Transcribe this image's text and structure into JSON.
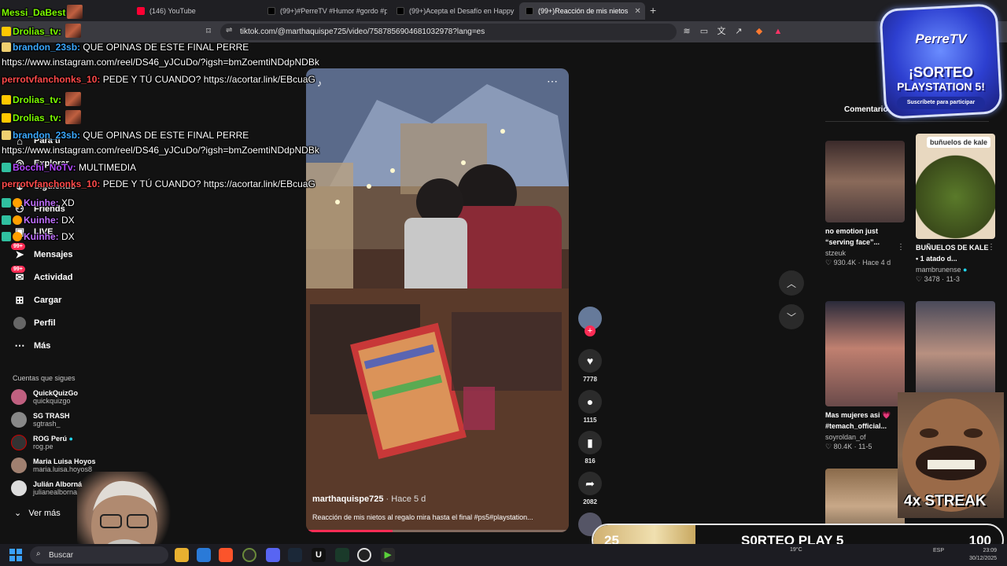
{
  "browser": {
    "tabs": [
      {
        "title": "(146) YouTube",
        "color": "#ff0033"
      },
      {
        "title": "(99+)#PerreTV #Humor #gordo #pe",
        "color": "#111111"
      },
      {
        "title": "(99+)Acepta el Desafío en Happy & G",
        "color": "#111111"
      },
      {
        "title": "(99+)Reacción de mis nietos",
        "color": "#111111"
      }
    ],
    "url": "tiktok.com/@marthaquispe725/video/7587856904681032978?lang=es"
  },
  "sidebar": {
    "nav": [
      {
        "label": "Para ti"
      },
      {
        "label": "Explorar"
      },
      {
        "label": "Siguiendo"
      },
      {
        "label": "Friends"
      },
      {
        "label": "LIVE"
      },
      {
        "label": "Mensajes",
        "badge": "99+"
      },
      {
        "label": "Actividad",
        "badge": "99+"
      },
      {
        "label": "Cargar"
      },
      {
        "label": "Perfil"
      },
      {
        "label": "Más"
      }
    ],
    "following_title": "Cuentas que sigues",
    "accounts": [
      {
        "name": "QuickQuizGo",
        "handle": "quickquizgo"
      },
      {
        "name": "SG TRASH",
        "handle": "sgtrash_"
      },
      {
        "name": "ROG Perú",
        "handle": "rog.pe"
      },
      {
        "name": "Maria Luisa Hoyos",
        "handle": "maria.luisa.hoyos8"
      },
      {
        "name": "Julián Alborná",
        "handle": "julianealborna"
      }
    ],
    "see_more": "Ver más"
  },
  "video": {
    "author": "marthaquispe725",
    "time": "· Hace 5 d",
    "caption": "Reacción de mis nietos al regalo mira hasta el final #ps5#playstation...",
    "progress": 0.33
  },
  "actions": {
    "likes": "7778",
    "comments": "1115",
    "saves": "816",
    "shares": "2082"
  },
  "right_panel": {
    "tab": "Comentarios",
    "cards": [
      {
        "title": "no emotion just “serving face”...",
        "user": "stzeuk",
        "meta": "♡ 930.4K · Hace 4 d",
        "thumb": "#6a4a3a"
      },
      {
        "title": "BUÑUELOS DE KALE • 1 atado d...",
        "user": "mambrunense",
        "meta": "♡ 3478 · 11-3",
        "thumb": "#4a5a2a",
        "overlay": "buñuelos de kale"
      },
      {
        "title": "Mas mujeres asi 💗 #temach_official...",
        "user": "soyroldan_of",
        "meta": "♡ 80.4K · 11-5",
        "thumb": "#7a5a6a"
      },
      {
        "title": "",
        "user": "",
        "meta": "",
        "thumb": "#5a5a6a"
      }
    ]
  },
  "chat": [
    {
      "user": "Messi_DaBest",
      "color": "#7cfc00",
      "text": ""
    },
    {
      "user": "Drolias_tv:",
      "color": "#7cfc00",
      "text": ""
    },
    {
      "user": "brandon_23sb:",
      "color": "#3aa8ff",
      "text": "QUE OPINAS DE ESTE FINAL PERRE"
    },
    {
      "user": "",
      "color": "#ffffff",
      "text": "https://www.instagram.com/reel/DS46_yJCuDo/?igsh=bmZoemtiNDdpNDBk"
    },
    {
      "user": "perrotvfanchonks_10:",
      "color": "#ff4a4a",
      "text": "PEDE Y TÚ CUANDO?  https://acortar.link/EBcuaG"
    },
    {
      "user": "Drolias_tv:",
      "color": "#7cfc00",
      "text": ""
    },
    {
      "user": "Drolias_tv:",
      "color": "#7cfc00",
      "text": ""
    },
    {
      "user": "brandon_23sb:",
      "color": "#3aa8ff",
      "text": "QUE OPINAS DE ESTE FINAL PERRE"
    },
    {
      "user": "",
      "color": "#ffffff",
      "text": "https://www.instagram.com/reel/DS46_yJCuDo/?igsh=bmZoemtiNDdpNDBk"
    },
    {
      "user": "Bocchi_NoTv:",
      "color": "#b44aff",
      "text": "MULTIMEDIA"
    },
    {
      "user": "perrotvfanchonks_10:",
      "color": "#ff4a4a",
      "text": "PEDE Y TÚ CUANDO?  https://acortar.link/EBcuaG"
    },
    {
      "user": "Kuinhe:",
      "color": "#c070ff",
      "text": "XD"
    },
    {
      "user": "Kuinhe:",
      "color": "#c070ff",
      "text": "DX"
    },
    {
      "user": "Kuinhe:",
      "color": "#c070ff",
      "text": "DX"
    }
  ],
  "promo": {
    "brand": "PerreTV",
    "title_line1": "¡SORTEO",
    "title_line2": "PLAYSTATION 5!",
    "subtitle": "Suscríbete para participar"
  },
  "streak": "4x STREAK",
  "goal": {
    "current": "25",
    "label": "S0RTEO PLAY 5",
    "target": "100",
    "fraction": 0.25
  },
  "taskbar": {
    "search": "Buscar",
    "weather": "19°C",
    "lang": "ESP",
    "time": "23:09",
    "date": "30/12/2025"
  },
  "colors": {
    "tiktok_red": "#fe2c55",
    "page_bg": "#121212"
  }
}
